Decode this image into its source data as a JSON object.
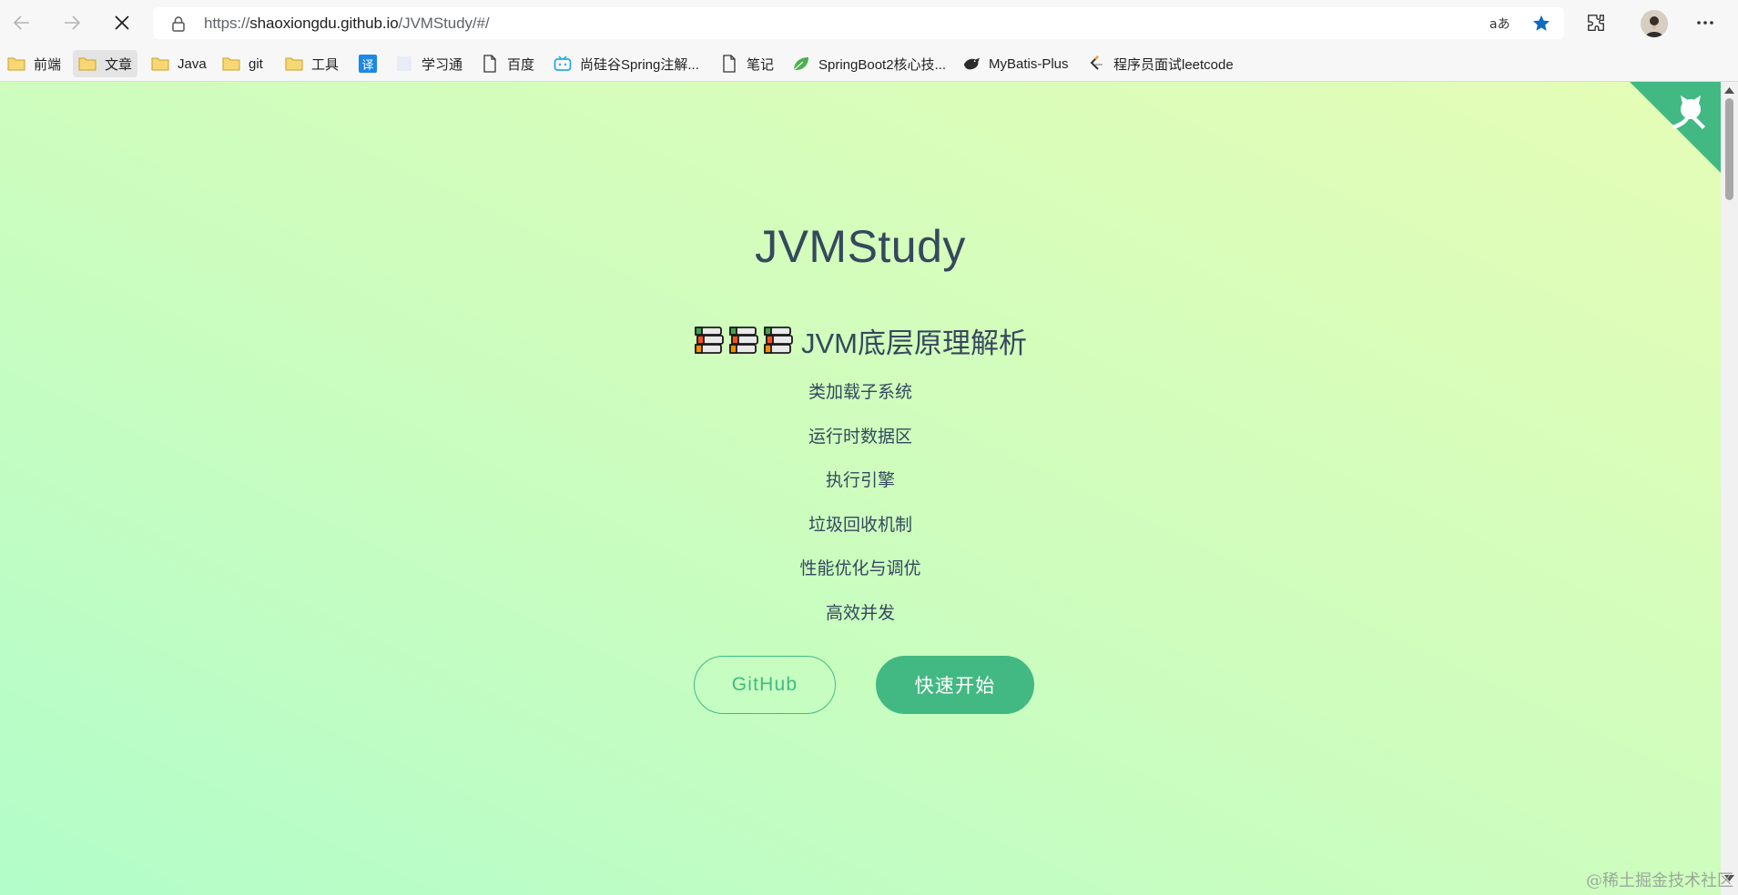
{
  "browser": {
    "url_prefix": "https://",
    "url_host": "shaoxiongdu.github.io",
    "url_path": "/JVMStudy/#/",
    "icons": [
      "back-arrow-icon",
      "forward-arrow-icon",
      "stop-loading-icon",
      "lock-icon",
      "read-aloud-icon",
      "favorite-star-icon",
      "extensions-icon",
      "avatar",
      "more-menu-icon"
    ]
  },
  "bookmarks": [
    {
      "label": "前端",
      "icon": "folder-icon"
    },
    {
      "label": "文章",
      "icon": "folder-icon"
    },
    {
      "label": "Java",
      "icon": "folder-icon"
    },
    {
      "label": "git",
      "icon": "folder-icon"
    },
    {
      "label": "工具",
      "icon": "folder-icon"
    },
    {
      "label": "",
      "icon": "translate-icon",
      "icon_text": "译"
    },
    {
      "label": "学习通",
      "icon": "page-icon"
    },
    {
      "label": "百度",
      "icon": "document-icon"
    },
    {
      "label": "尚硅谷Spring注解...",
      "icon": "bilibili-icon"
    },
    {
      "label": "笔记",
      "icon": "document-icon"
    },
    {
      "label": "SpringBoot2核心技...",
      "icon": "leaf-icon"
    },
    {
      "label": "MyBatis-Plus",
      "icon": "bird-icon"
    },
    {
      "label": "程序员面试leetcode",
      "icon": "leetcode-icon"
    }
  ],
  "cover": {
    "title": "JVMStudy",
    "subtitle": "JVM底层原理解析",
    "items": [
      "类加载子系统",
      "运行时数据区",
      "执行引擎",
      "垃圾回收机制",
      "性能优化与调优",
      "高效并发"
    ],
    "github_button": "GitHub",
    "start_button": "快速开始"
  },
  "colors": {
    "accent": "#42b983",
    "text": "#34495e",
    "gradient_start": "#b2fdc9",
    "gradient_end": "#e5fdb6"
  },
  "watermark": "@稀土掘金技术社区"
}
